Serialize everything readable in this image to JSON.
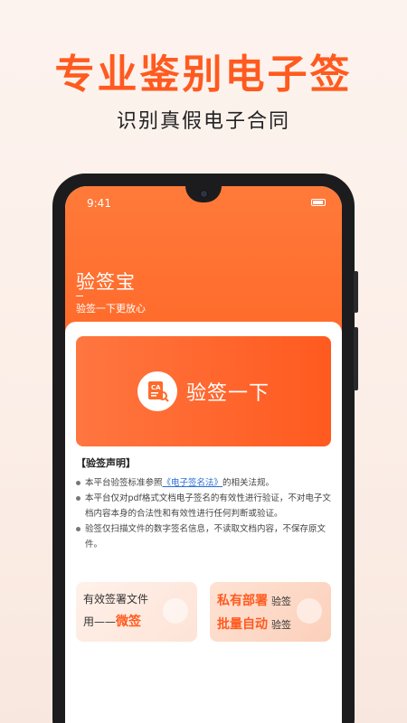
{
  "promo": {
    "headline": "专业鉴别电子签",
    "subheadline": "识别真假电子合同"
  },
  "status_bar": {
    "time": "9:41"
  },
  "app": {
    "title": "验签宝",
    "tagline": "验签一下更放心"
  },
  "verify_button": {
    "label": "验签一下"
  },
  "declaration": {
    "title": "【验签声明】",
    "item1_prefix": "本平台验签标准参照",
    "item1_link": "《电子签名法》",
    "item1_suffix": "的相关法规。",
    "item2": "本平台仅对pdf格式文档电子签名的有效性进行验证，不对电子文档内容本身的合法性和有效性进行任何判断或验证。",
    "item3": "验签仅扫描文件的数字签名信息，不读取文档内容，不保存原文件。"
  },
  "feature_cards": {
    "left": {
      "line1": "有效签署文件",
      "line2_prefix": "用——",
      "line2_accent": "微签"
    },
    "right": {
      "row1_accent": "私有部署",
      "row1_small": "验签",
      "row2_accent": "批量自动",
      "row2_small": "验签"
    }
  },
  "icons": {
    "verify": "ca-document-verify-icon"
  },
  "colors": {
    "accent": "#ff5a1f",
    "header": "#ff6a2a",
    "link": "#2a6ed6"
  }
}
